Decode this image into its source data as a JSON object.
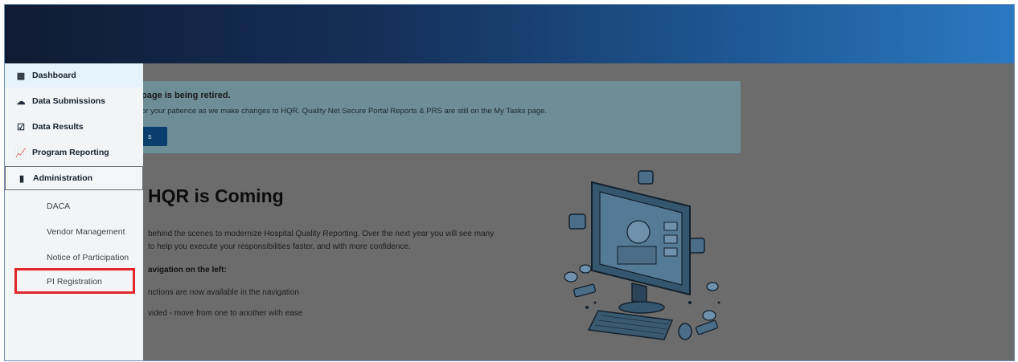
{
  "sidebar": {
    "items": [
      {
        "label": "Dashboard",
        "icon": "grid-icon"
      },
      {
        "label": "Data Submissions",
        "icon": "cloud-upload-icon"
      },
      {
        "label": "Data Results",
        "icon": "checkbox-icon"
      },
      {
        "label": "Program Reporting",
        "icon": "line-chart-icon"
      },
      {
        "label": "Administration",
        "icon": "clipboard-icon"
      }
    ],
    "sub_items": [
      "DACA",
      "Vendor Management",
      "Notice of Participation",
      "PI Registration"
    ],
    "highlighted_item": "PI Registration",
    "highlight_color": "#e0262b"
  },
  "banner": {
    "title": "page is being retired.",
    "text": "or your patience as we make changes to HQR. Quality Net Secure Portal Reports & PRS are still on the My Tasks page.",
    "button_label": "s"
  },
  "hero": {
    "title": "HQR is Coming",
    "desc_line1": "behind the scenes to modernize Hospital Quality Reporting. Over the next year you will see many",
    "desc_line2": "to help you execute your responsibilities faster, and with more confidence.",
    "nav_heading": "avigation on the left:",
    "bullet1": "nctions are now available in the navigation",
    "bullet2": "vided - move from one to another with ease"
  },
  "colors": {
    "header_start": "#0f1b33",
    "header_end": "#2c79c2",
    "overlay": "#6c6c6c",
    "active_nav": "#e5f3fa"
  }
}
